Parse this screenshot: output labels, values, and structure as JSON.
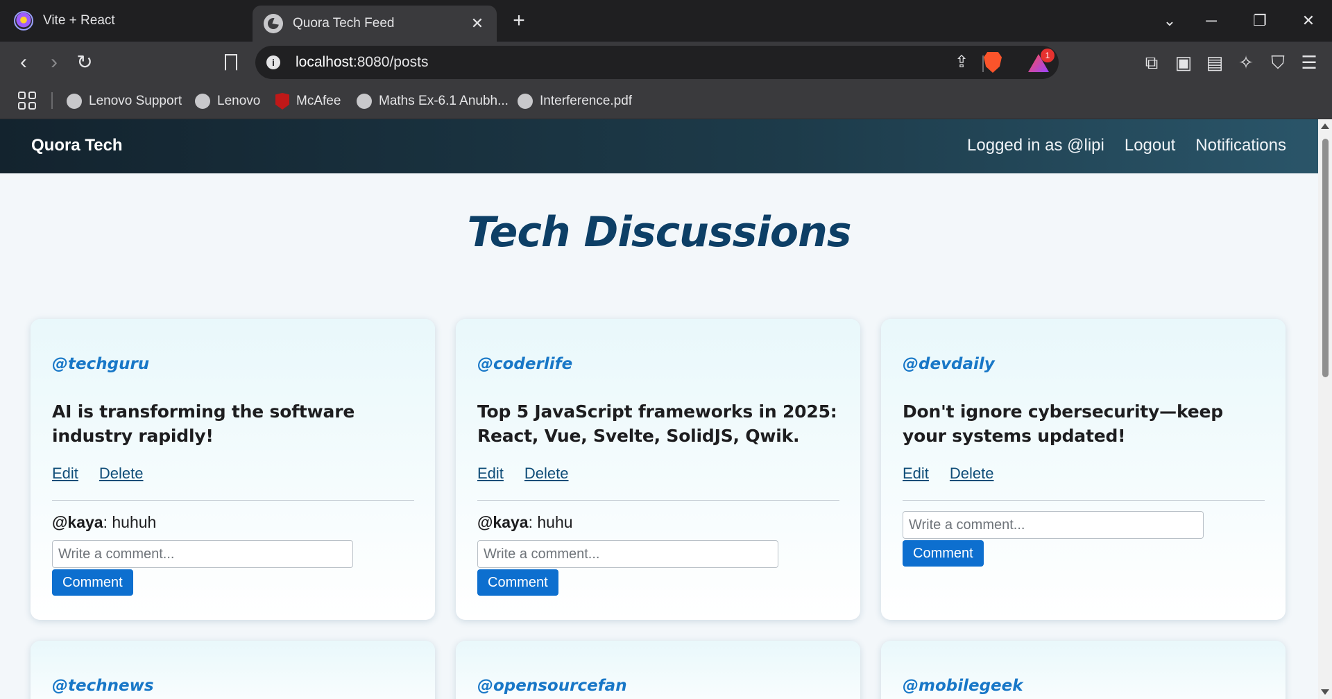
{
  "browser": {
    "tabs": [
      {
        "label": "Vite + React",
        "icon": "vite-icon",
        "active": false
      },
      {
        "label": "Quora Tech Feed",
        "icon": "globe-icon",
        "active": true
      }
    ],
    "url_host": "localhost",
    "url_path": ":8080/posts",
    "rewards_badge": "1",
    "bookmarks": [
      {
        "label": "Lenovo Support",
        "icon": "globe-icon"
      },
      {
        "label": "Lenovo",
        "icon": "globe-icon"
      },
      {
        "label": "McAfee",
        "icon": "mcafee-icon"
      },
      {
        "label": "Maths Ex-6.1 Anubh...",
        "icon": "globe-icon"
      },
      {
        "label": "Interference.pdf",
        "icon": "globe-icon"
      }
    ]
  },
  "app": {
    "brand": "Quora Tech",
    "nav": {
      "logged_in": "Logged in as @lipi",
      "logout": "Logout",
      "notifications": "Notifications"
    },
    "heading": "Tech Discussions",
    "posts": [
      {
        "author": "@techguru",
        "title": "AI is transforming the software industry rapidly!",
        "edit": "Edit",
        "delete": "Delete",
        "comments": [
          {
            "user": "@kaya",
            "text": ": huhuh"
          }
        ],
        "comment_placeholder": "Write a comment...",
        "comment_button": "Comment"
      },
      {
        "author": "@coderlife",
        "title": "Top 5 JavaScript frameworks in 2025: React, Vue, Svelte, SolidJS, Qwik.",
        "edit": "Edit",
        "delete": "Delete",
        "comments": [
          {
            "user": "@kaya",
            "text": ": huhu"
          }
        ],
        "comment_placeholder": "Write a comment...",
        "comment_button": "Comment"
      },
      {
        "author": "@devdaily",
        "title": "Don't ignore cybersecurity—keep your systems updated!",
        "edit": "Edit",
        "delete": "Delete",
        "comments": [],
        "comment_placeholder": "Write a comment...",
        "comment_button": "Comment"
      },
      {
        "author": "@technews"
      },
      {
        "author": "@opensourcefan"
      },
      {
        "author": "@mobilegeek"
      }
    ]
  },
  "colors": {
    "nav_gradient_start": "#13232e",
    "nav_gradient_end": "#2a5569",
    "heading": "#0d3f66",
    "author": "#1877c7",
    "button": "#0d6fcf"
  }
}
